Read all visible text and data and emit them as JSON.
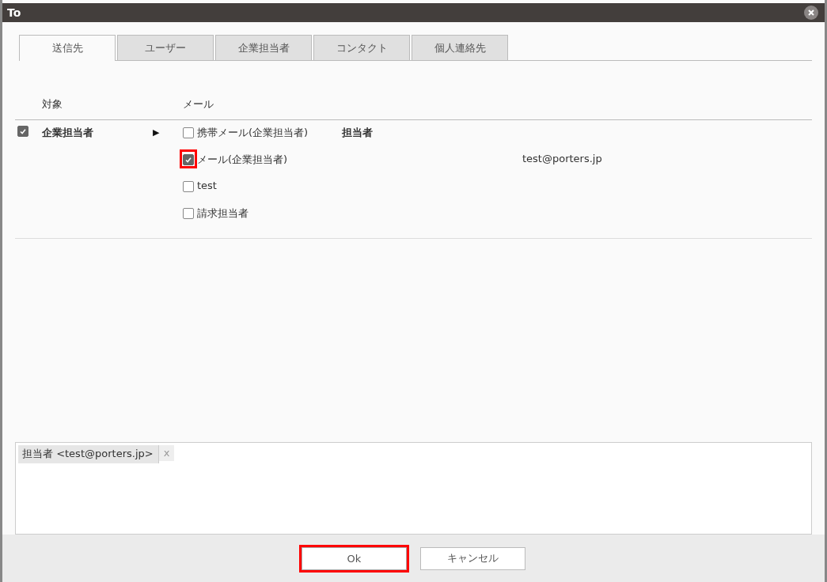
{
  "window": {
    "title": "To"
  },
  "tabs": [
    {
      "label": "送信先",
      "selected": true
    },
    {
      "label": "ユーザー",
      "selected": false
    },
    {
      "label": "企業担当者",
      "selected": false
    },
    {
      "label": "コンタクト",
      "selected": false
    },
    {
      "label": "個人連絡先",
      "selected": false
    }
  ],
  "table": {
    "columns": [
      "対象",
      "メール"
    ],
    "rows": [
      {
        "checked": true,
        "target": "企業担当者",
        "expand_glyph": "▶",
        "options": [
          {
            "label": "携帯メール(企業担当者)",
            "checked": false,
            "highlighted": false,
            "contact": "担当者"
          },
          {
            "label": "メール(企業担当者)",
            "checked": true,
            "highlighted": true,
            "email": "test@porters.jp"
          },
          {
            "label": "test",
            "checked": false,
            "highlighted": false
          },
          {
            "label": "請求担当者",
            "checked": false,
            "highlighted": false
          }
        ]
      }
    ]
  },
  "recipients": [
    {
      "label": "担当者 <test@porters.jp>",
      "remove": "x"
    }
  ],
  "buttons": [
    {
      "label": "Ok",
      "kind": "primary",
      "highlighted": true
    },
    {
      "label": "キャンセル",
      "kind": "cancel",
      "highlighted": false
    }
  ]
}
